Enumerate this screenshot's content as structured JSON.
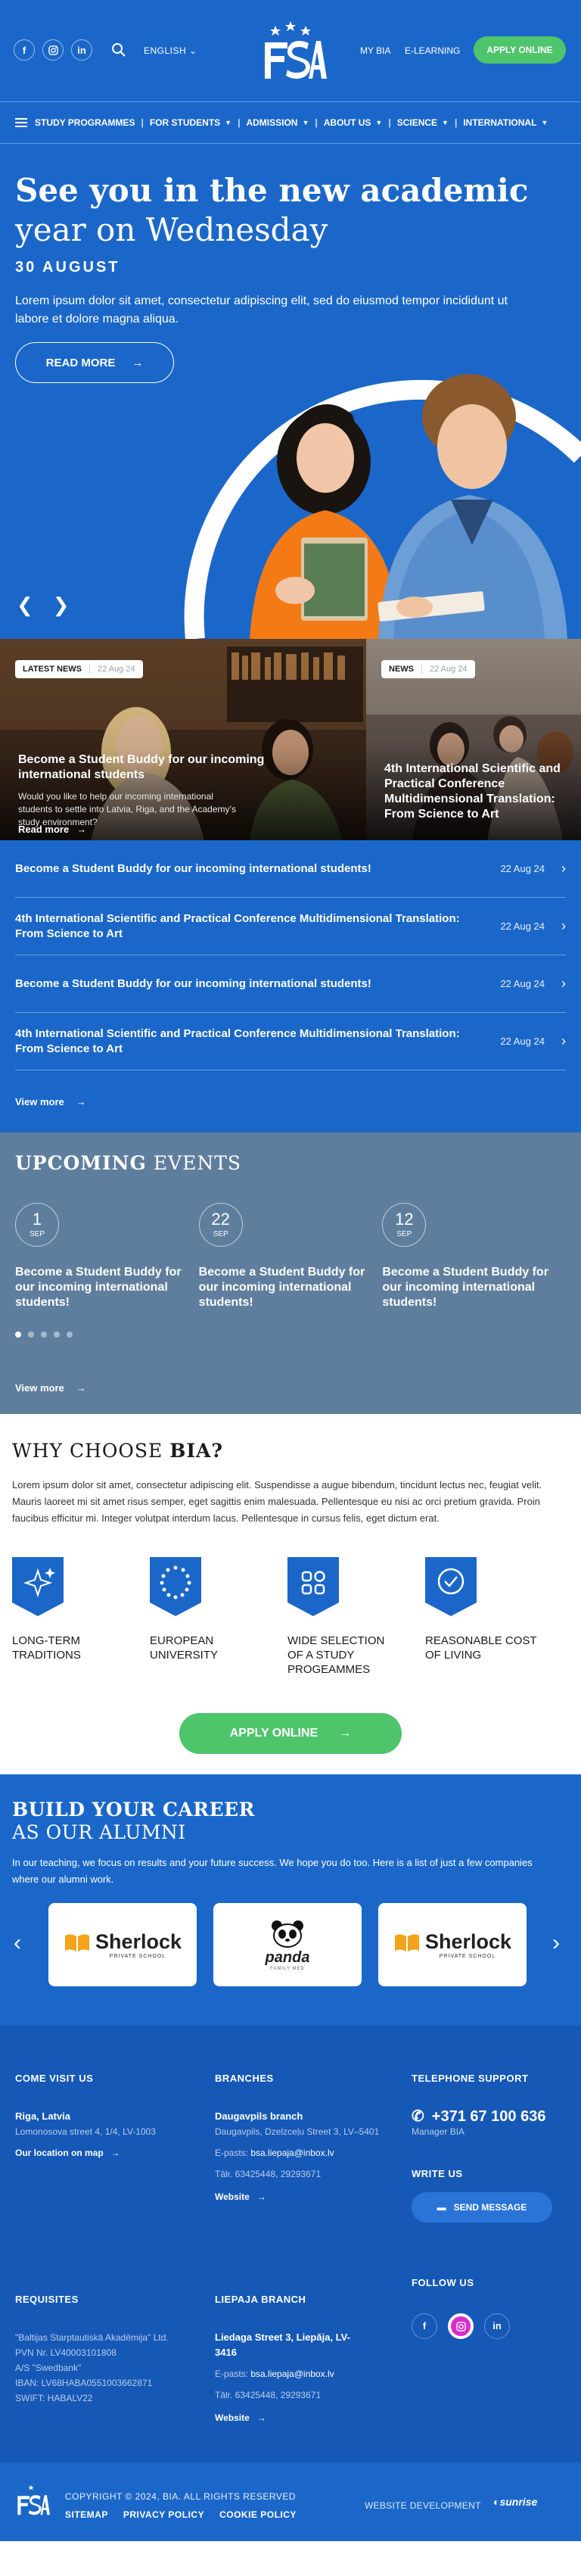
{
  "header": {
    "language": "ENGLISH",
    "my_bia": "MY BIA",
    "elearning": "E-LEARNING",
    "apply": "APPLY ONLINE"
  },
  "nav": {
    "items": [
      "STUDY PROGRAMMES",
      "FOR STUDENTS",
      "ADMISSION",
      "ABOUT US",
      "SCIENCE",
      "INTERNATIONAL"
    ]
  },
  "hero": {
    "title_bold": "See you in the new academic",
    "title_rest": "year on Wednesday",
    "date": "30 AUGUST",
    "lead": "Lorem ipsum dolor sit amet, consectetur adipiscing elit, sed do eiusmod tempor incididunt ut labore et dolore magna aliqua.",
    "read_more": "READ MORE"
  },
  "news_cards": [
    {
      "tag": "LATEST NEWS",
      "date": "22 Aug 24",
      "title": "Become a Student Buddy for our incoming international students",
      "desc": "Would you like to help our incoming international students to settle into Latvia, Riga, and the Academy’s study environment?",
      "more": "Read more"
    },
    {
      "tag": "NEWS",
      "date": "22 Aug 24",
      "title": "4th International Scientific and Practical Conference Multidimensional Translation: From Science to Art"
    }
  ],
  "news_list": [
    {
      "title": "Become a Student Buddy for our incoming international students!",
      "date": "22 Aug 24"
    },
    {
      "title": "4th International Scientific and Practical Conference Multidimensional Translation: From Science to Art",
      "date": "22 Aug 24"
    },
    {
      "title": "Become a Student Buddy for our incoming international students!",
      "date": "22 Aug 24"
    },
    {
      "title": "4th International Scientific and Practical Conference Multidimensional Translation: From Science to Art",
      "date": "22 Aug 24"
    }
  ],
  "view_more": "View more",
  "events": {
    "title_bold": "UPCOMING",
    "title_rest": "EVENTS",
    "items": [
      {
        "day": "1",
        "month": "SEP",
        "title": "Become a Student Buddy for our incoming international students!"
      },
      {
        "day": "22",
        "month": "SEP",
        "title": "Become a Student Buddy for our incoming international students!"
      },
      {
        "day": "12",
        "month": "SEP",
        "title": "Become a Student Buddy for our incoming international students!"
      }
    ],
    "view_more": "View more"
  },
  "why": {
    "title_rest": "WHY CHOOSE",
    "title_bold": "BIA?",
    "text": "Lorem ipsum dolor sit amet, consectetur adipiscing elit. Suspendisse a augue bibendum, tincidunt lectus nec, feugiat velit. Mauris laoreet mi sit amet risus semper, eget sagittis enim malesuada. Pellentesque eu nisi ac orci pretium gravida. Proin faucibus efficitur mi. Integer volutpat interdum lacus. Pellentesque in cursus felis, eget dictum erat.",
    "features": [
      "LONG-TERM TRADITIONS",
      "EUROPEAN UNIVERSITY",
      "WIDE SELECTION OF A STUDY PROGEAMMES",
      "REASONABLE COST OF LIVING"
    ],
    "apply": "APPLY ONLINE"
  },
  "career": {
    "title_bold": "BUILD YOUR CAREER",
    "title_rest": "AS OUR ALUMNI",
    "text": "In our teaching, we focus on results and your future success. We hope you do too. Here is a list of just a few companies where our alumni work.",
    "logos": [
      {
        "name": "Sherlock",
        "sub": "PRIVATE SCHOOL"
      },
      {
        "name": "panda",
        "sub": "FAMILY MED"
      },
      {
        "name": "Sherlock",
        "sub": "PRIVATE SCHOOL"
      }
    ]
  },
  "footer": {
    "visit": {
      "heading": "COME VISIT US",
      "city": "Riga, Latvia",
      "address": "Lomonosova street 4, 1/4, LV-1003",
      "map": "Our location on map"
    },
    "branches": {
      "heading": "BRANCHES",
      "name": "Daugavpils branch",
      "address": "Daugavpils, Dzelzceļu Street 3, LV–5401",
      "email_label": "E-pasts:",
      "email": "bsa.liepaja@inbox.lv",
      "phone": "Tālr. 63425448, 29293671",
      "website": "Website"
    },
    "support": {
      "heading": "TELEPHONE SUPPORT",
      "phone": "+371 67 100 636",
      "manager": "Manager BIA"
    },
    "write": {
      "heading": "WRITE US",
      "button": "SEND MESSAGE"
    },
    "requisites": {
      "heading": "REQUISITES",
      "lines": [
        "\"Baltijas Starptautiskā Akadēmija\" Ltd.",
        "PVN Nr. LV40003101808",
        "A/S \"Swedbank\"",
        "IBAN: LV68HABA0551003662871",
        "SWIFT: HABALV22"
      ]
    },
    "liepaja": {
      "heading": "LIEPAJA BRANCH",
      "address": "Liedaga Street 3, Liepāja, LV-3416",
      "email_label": "E-pasts:",
      "email": "bsa.liepaja@inbox.lv",
      "phone": "Tālr. 63425448, 29293671",
      "website": "Website"
    },
    "follow": {
      "heading": "FOLLOW US"
    }
  },
  "copybar": {
    "copyright": "COPYRIGHT © 2024, BIA. ALL RIGHTS RESERVED",
    "links": [
      "SITEMAP",
      "PRIVACY POLICY",
      "COOKIE POLICY"
    ],
    "dev_label": "WEBSITE DEVELOPMENT",
    "dev_name": "sunrise"
  },
  "colors": {
    "primary_blue": "#1b67c9",
    "green": "#4ec46b",
    "events_bg": "#5f7e9e",
    "footer_bg": "#1658b6"
  }
}
